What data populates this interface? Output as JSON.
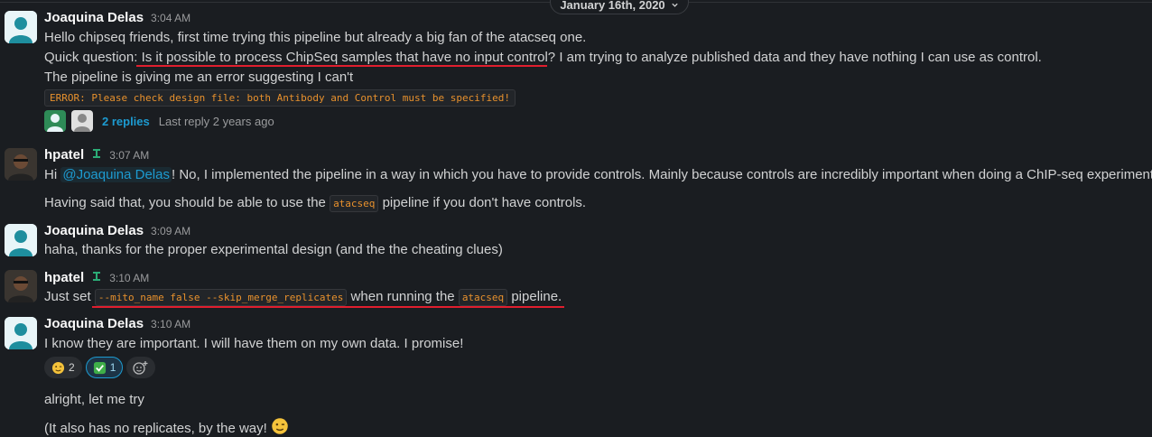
{
  "date_divider": {
    "label": "January 16th, 2020"
  },
  "messages": [
    {
      "author": "Joaquina Delas",
      "time": "3:04 AM",
      "lines": [
        "Hello chipseq friends, first time trying this pipeline but already a big fan of the atacseq one.",
        "Quick question:",
        "Is it possible to process ChipSeq samples that have no input control?",
        " I am trying to analyze published data and they have nothing I can use as control.",
        "The pipeline is giving me an error suggesting I can't"
      ],
      "code": "ERROR: Please check design file: both Antibody and Control must be specified!",
      "thread": {
        "replies": "2 replies",
        "last_reply": "Last reply 2 years ago"
      }
    },
    {
      "author": "hpatel",
      "time": "3:07 AM",
      "line1_pre": "Hi ",
      "mention": "@Joaquina Delas",
      "line1_post": "! No, I implemented the pipeline in a way in which you have to provide controls. Mainly because controls are incredibly important when doing a ChIP-seq experiment!!",
      "line2_pre": "Having said that, you should be able to use the ",
      "line2_code": "atacseq",
      "line2_post": " pipeline if you don't have controls."
    },
    {
      "author": "Joaquina Delas",
      "time": "3:09 AM",
      "text": "haha, thanks for the proper experimental design (and the the cheating clues)"
    },
    {
      "author": "hpatel",
      "time": "3:10 AM",
      "pre": "Just set ",
      "code1": "--mito_name false --skip_merge_replicates",
      "mid": " when running the ",
      "code2": "atacseq",
      "post": " pipeline."
    },
    {
      "author": "Joaquina Delas",
      "time": "3:10 AM",
      "text": "I know they are important. I will have them on my own data. I promise!",
      "reactions": [
        {
          "emoji": "wink-emoji",
          "count": "2"
        },
        {
          "emoji": "check-mark-emoji",
          "count": "1"
        }
      ],
      "followups": [
        "alright, let me try",
        "(It also has no replicates, by the way!"
      ]
    }
  ],
  "colors": {
    "background": "#1a1d21",
    "link": "#1d9bd1",
    "code": "#e8912d",
    "annotation_underline": "#e01e2e"
  }
}
